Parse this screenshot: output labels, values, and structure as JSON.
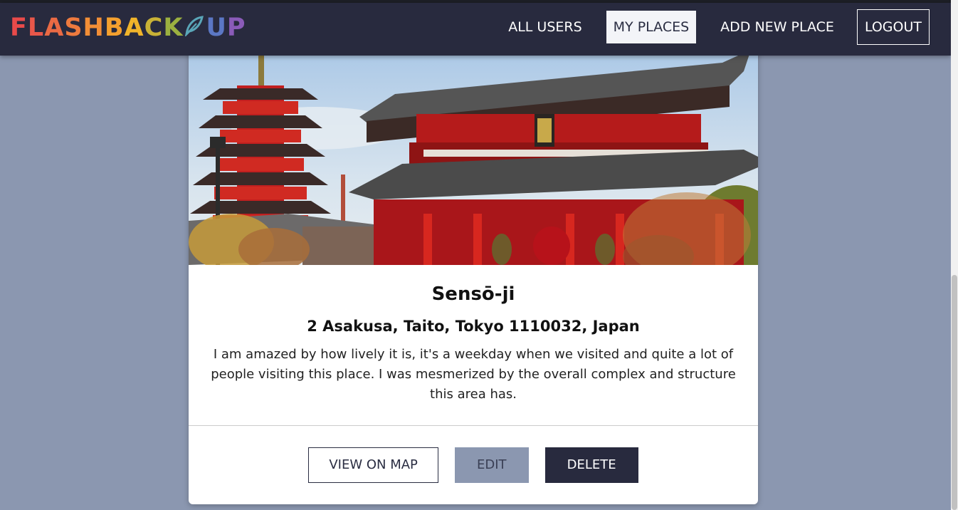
{
  "app": {
    "logo_letters": [
      "F",
      "L",
      "A",
      "S",
      "H",
      "B",
      "A",
      "C",
      "K",
      "U",
      "P"
    ],
    "logo_colors": [
      "#e84a4a",
      "#e8574a",
      "#ea6a44",
      "#ee7a3e",
      "#f28e36",
      "#f4a02e",
      "#f0b42a",
      "#c9b236",
      "#6f8ac8",
      "#5b77c4",
      "#8a5bb8"
    ]
  },
  "nav": {
    "all_users": "ALL USERS",
    "my_places": "MY PLACES",
    "add_new_place": "ADD NEW PLACE",
    "logout": "LOGOUT"
  },
  "place": {
    "image_alt": "Sensō-ji",
    "title": "Sensō-ji",
    "address": "2 Asakusa, Taito, Tokyo 1110032, Japan",
    "description": "I am amazed by how lively it is, it's a weekday when we visited and quite a lot of people visiting this place. I was mesmerized by the overall complex and structure this area has."
  },
  "actions": {
    "view_on_map": "VIEW ON MAP",
    "edit": "EDIT",
    "delete": "DELETE"
  },
  "colors": {
    "header_bg": "#282a3e",
    "page_bg": "#8b97b0",
    "delete_bg": "#282a3e",
    "edit_bg": "#8b97b0"
  }
}
